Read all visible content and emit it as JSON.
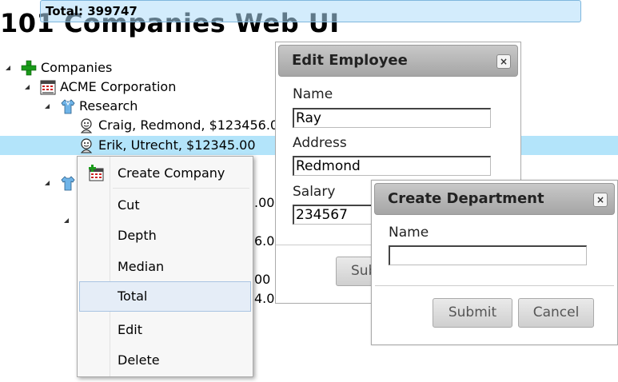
{
  "header": {
    "title": "101 Companies Web UI",
    "total_banner": "Total: 399747"
  },
  "tree": {
    "root": "Companies",
    "company": "ACME Corporation",
    "department": "Research",
    "employees": [
      "Craig, Redmond, $123456.00",
      "Erik, Utrecht, $12345.00"
    ],
    "partial_values": [
      ".00",
      "6.00",
      "00",
      "4.0"
    ]
  },
  "context_menu": {
    "items": [
      "Create Company",
      "Cut",
      "Depth",
      "Median",
      "Total",
      "Edit",
      "Delete"
    ],
    "hovered": "Total"
  },
  "edit_employee": {
    "title": "Edit Employee",
    "name_label": "Name",
    "name_value": "Ray",
    "address_label": "Address",
    "address_value": "Redmond",
    "salary_label": "Salary",
    "salary_value": "234567",
    "submit_partial": "Sub"
  },
  "create_department": {
    "title": "Create Department",
    "name_label": "Name",
    "name_value": "",
    "submit_label": "Submit",
    "cancel_label": "Cancel"
  },
  "icons": {
    "close": "×"
  }
}
